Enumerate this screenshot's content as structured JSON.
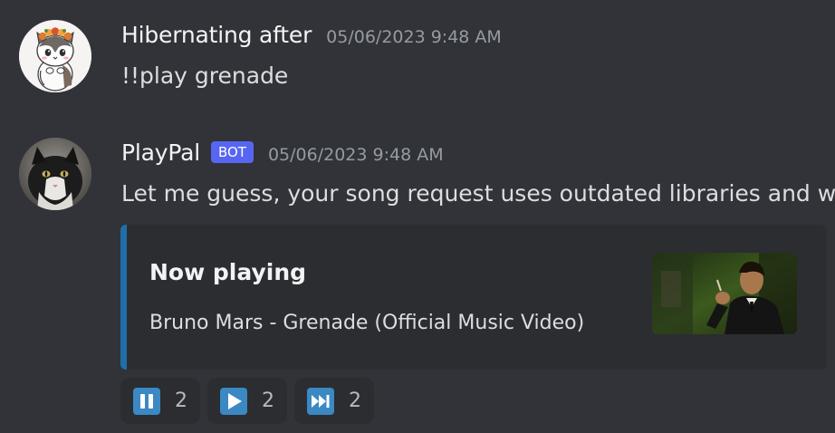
{
  "messages": [
    {
      "username": "Hibernating after",
      "timestamp": "05/06/2023 9:48 AM",
      "content": "!!play grenade",
      "avatar_icon": "cat-avatar-with-flower-crown"
    },
    {
      "username": "PlayPal",
      "bot_tag": "BOT",
      "timestamp": "05/06/2023 9:48 AM",
      "content": "Let me guess, your song request uses outdated libraries and will make me crash",
      "avatar_icon": "black-white-cat-photo-avatar",
      "embed": {
        "accent_color": "#1f6fa9",
        "title": "Now playing",
        "description": "Bruno Mars - Grenade (Official Music Video)",
        "thumbnail_icon": "music-video-thumbnail"
      },
      "reactions": [
        {
          "icon": "pause-button-emoji",
          "count": "2"
        },
        {
          "icon": "play-button-emoji",
          "count": "2"
        },
        {
          "icon": "next-track-button-emoji",
          "count": "2"
        }
      ]
    }
  ],
  "colors": {
    "background": "#313338",
    "embed_background": "#2b2d31",
    "bot_tag": "#5865f2",
    "reaction_emoji": "#3b88c3"
  }
}
